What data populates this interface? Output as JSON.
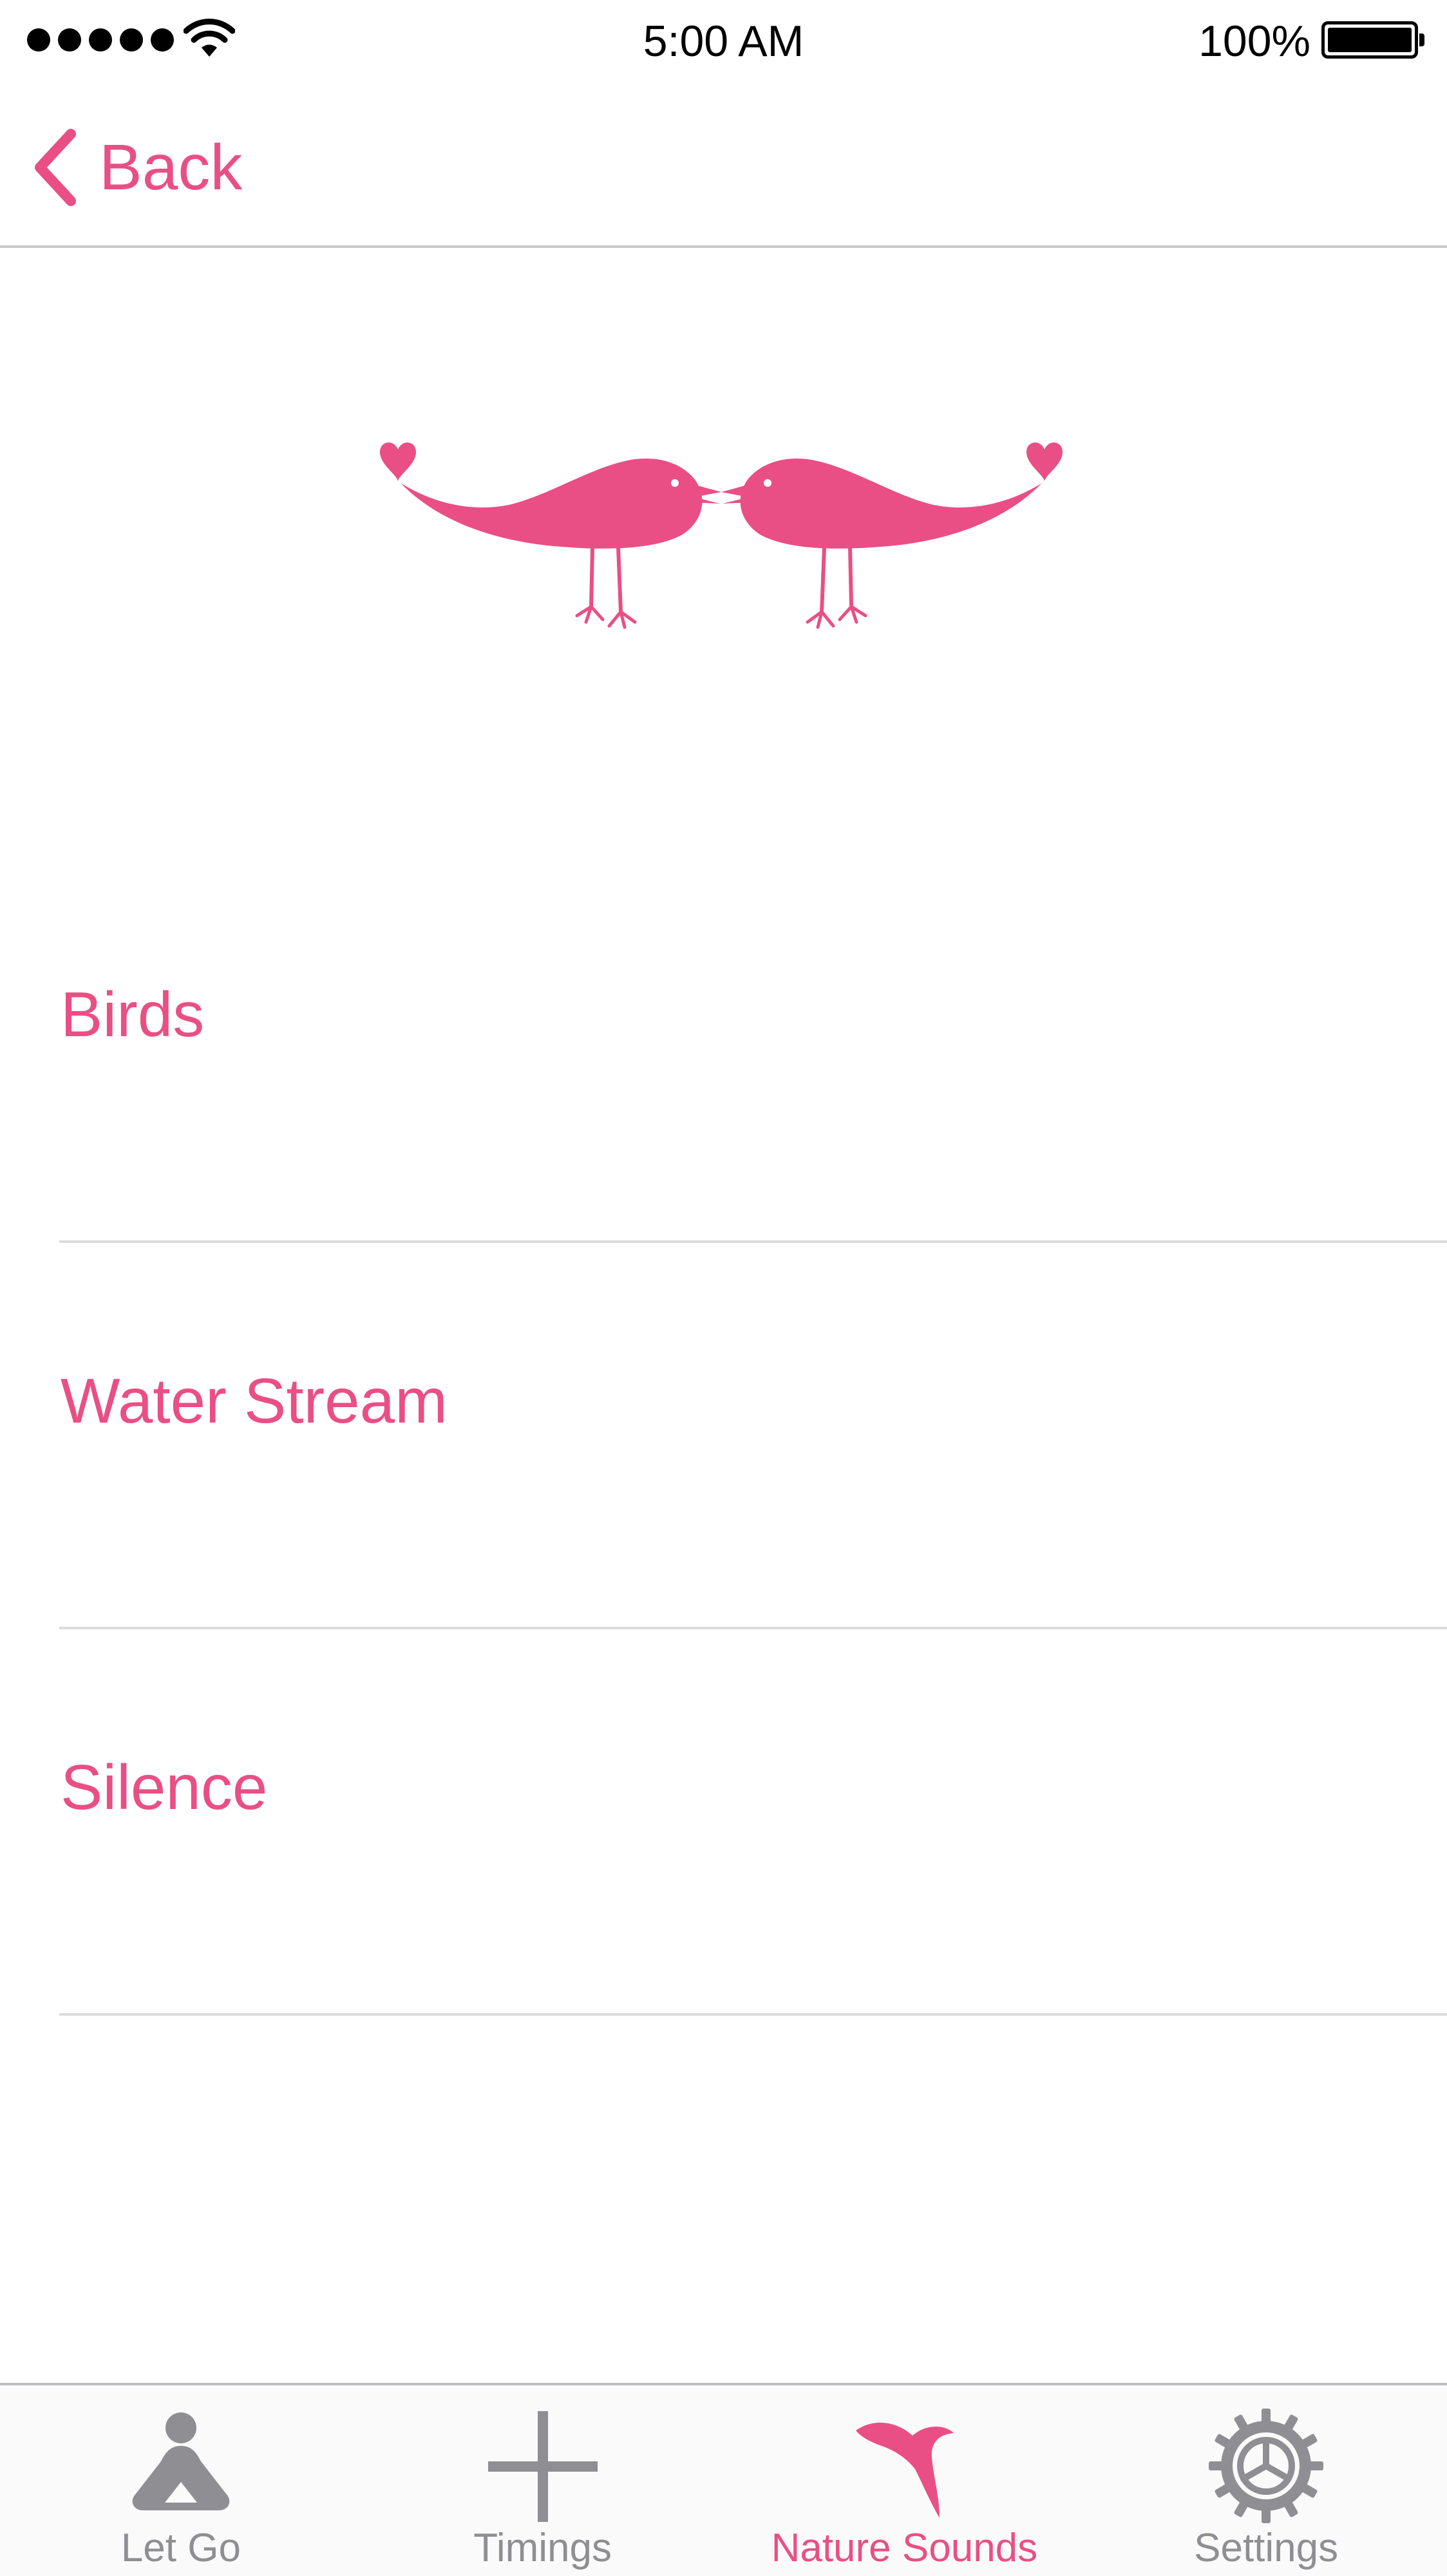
{
  "status_bar": {
    "time": "5:00 AM",
    "battery": "100%",
    "icons": [
      "signal-dots-icon",
      "wifi-icon",
      "battery-icon"
    ]
  },
  "nav": {
    "back_label": "Back",
    "back_icon": "chevron-left-icon"
  },
  "hero": {
    "icon": "love-birds-illustration"
  },
  "sounds": {
    "items": [
      {
        "label": "Birds"
      },
      {
        "label": "Water Stream"
      },
      {
        "label": "Silence"
      }
    ]
  },
  "tabs": {
    "items": [
      {
        "label": "Let Go",
        "icon": "meditation-icon",
        "active": false
      },
      {
        "label": "Timings",
        "icon": "plus-icon",
        "active": false
      },
      {
        "label": "Nature Sounds",
        "icon": "bird-icon",
        "active": true
      },
      {
        "label": "Settings",
        "icon": "gear-icon",
        "active": false
      }
    ]
  },
  "colors": {
    "accent": "#e94f84",
    "inactive": "#8e8e93",
    "separator": "#dcdcdc"
  }
}
